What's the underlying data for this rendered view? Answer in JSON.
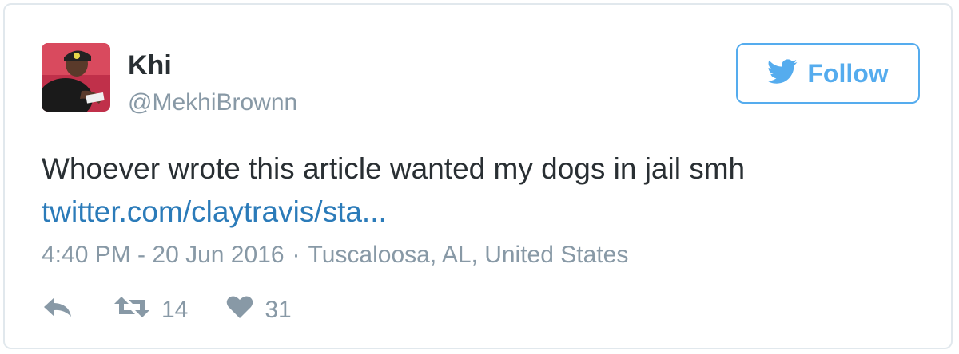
{
  "tweet": {
    "author": {
      "display_name": "Khi",
      "handle": "@MekhiBrownn"
    },
    "follow_label": "Follow",
    "text": "Whoever wrote this article wanted my dogs in jail smh",
    "link_text": "twitter.com/claytravis/sta...",
    "time": "4:40 PM - 20 Jun 2016",
    "separator": "·",
    "location": "Tuscaloosa, AL, United States",
    "retweet_count": "14",
    "like_count": "31"
  },
  "colors": {
    "accent": "#55acee",
    "link": "#2b7bb9",
    "text": "#292f33",
    "muted": "#8899a6",
    "border": "#e1e8ed"
  },
  "icons": {
    "follow": "twitter-bird-icon",
    "reply": "reply-icon",
    "retweet": "retweet-icon",
    "like": "heart-icon"
  }
}
